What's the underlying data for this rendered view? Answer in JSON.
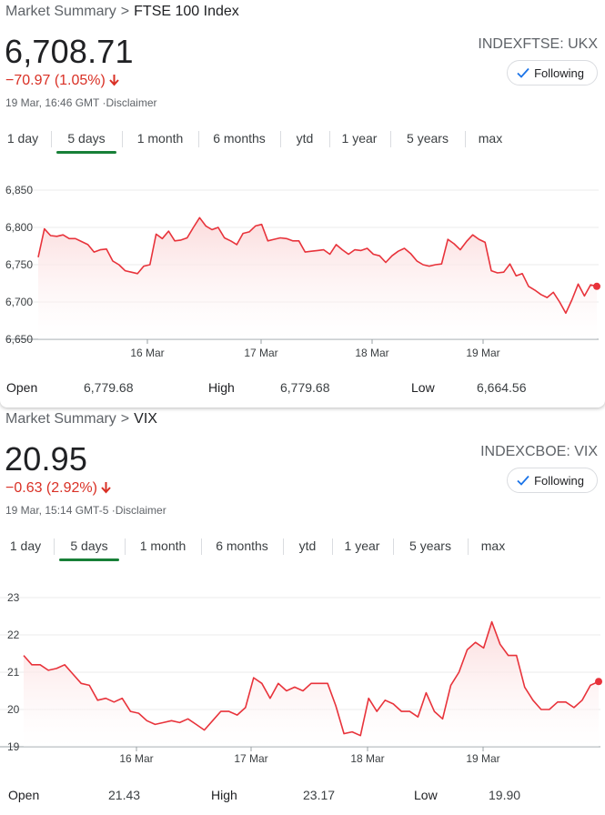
{
  "colors": {
    "line": "#e8333b",
    "fill_top": "#fbd9da",
    "grid": "#ebebeb",
    "active_tab": "#188038",
    "down": "#d93025"
  },
  "tabs": [
    "1 day",
    "5 days",
    "1 month",
    "6 months",
    "ytd",
    "1 year",
    "5 years",
    "max"
  ],
  "active_tab_index": 1,
  "cards": [
    {
      "breadcrumb": {
        "parent": "Market Summary",
        "separator": ">",
        "current": "FTSE 100 Index"
      },
      "price": "6,708.71",
      "change": "−70.97 (1.05%)",
      "change_icon": "arrow-down-icon",
      "timestamp": "19 Mar, 16:46 GMT ·Disclaimer",
      "ticker": "INDEXFTSE: UKX",
      "follow_label": "Following",
      "follow_icon": "check-icon",
      "stats": {
        "open_label": "Open",
        "open": "6,779.68",
        "high_label": "High",
        "high": "6,779.68",
        "low_label": "Low",
        "low": "6,664.56"
      },
      "chart_data": {
        "type": "area",
        "x_tick_labels": [
          "16 Mar",
          "17 Mar",
          "18 Mar",
          "19 Mar"
        ],
        "y_tick_labels": [
          "6,850",
          "6,800",
          "6,750",
          "6,700",
          "6,650"
        ],
        "y_ticks": [
          6850,
          6800,
          6750,
          6700,
          6650
        ],
        "ylim": [
          6650,
          6850
        ],
        "xlim": [
          0,
          4
        ],
        "values": [
          6760,
          6798,
          6789,
          6788,
          6790,
          6785,
          6785,
          6781,
          6777,
          6767,
          6770,
          6771,
          6755,
          6750,
          6742,
          6740,
          6738,
          6748,
          6750,
          6791,
          6785,
          6795,
          6782,
          6783,
          6786,
          6800,
          6813,
          6802,
          6797,
          6800,
          6786,
          6782,
          6777,
          6792,
          6794,
          6802,
          6804,
          6782,
          6784,
          6786,
          6785,
          6782,
          6782,
          6767,
          6768,
          6769,
          6770,
          6764,
          6777,
          6770,
          6764,
          6770,
          6769,
          6772,
          6764,
          6762,
          6753,
          6762,
          6768,
          6772,
          6765,
          6755,
          6750,
          6748,
          6750,
          6751,
          6784,
          6778,
          6770,
          6781,
          6790,
          6784,
          6780,
          6742,
          6739,
          6740,
          6751,
          6735,
          6738,
          6721,
          6716,
          6710,
          6706,
          6713,
          6700,
          6685,
          6703,
          6724,
          6708,
          6723,
          6721
        ],
        "last_point": 6721,
        "grid": true
      }
    },
    {
      "breadcrumb": {
        "parent": "Market Summary",
        "separator": ">",
        "current": "VIX"
      },
      "price": "20.95",
      "change": "−0.63 (2.92%)",
      "change_icon": "arrow-down-icon",
      "timestamp": "19 Mar, 15:14 GMT-5 ·Disclaimer",
      "ticker": "INDEXCBOE: VIX",
      "follow_label": "Following",
      "follow_icon": "check-icon",
      "stats": {
        "open_label": "Open",
        "open": "21.43",
        "high_label": "High",
        "high": "23.17",
        "low_label": "Low",
        "low": "19.90"
      },
      "chart_data": {
        "type": "area",
        "x_tick_labels": [
          "16 Mar",
          "17 Mar",
          "18 Mar",
          "19 Mar"
        ],
        "y_tick_labels": [
          "23",
          "22",
          "21",
          "20",
          "19"
        ],
        "y_ticks": [
          23,
          22,
          21,
          20,
          19
        ],
        "ylim": [
          19,
          23
        ],
        "xlim": [
          0,
          4
        ],
        "values": [
          21.45,
          21.2,
          21.2,
          21.05,
          21.1,
          21.2,
          20.95,
          20.7,
          20.65,
          20.25,
          20.3,
          20.2,
          20.3,
          19.95,
          19.9,
          19.7,
          19.6,
          19.65,
          19.7,
          19.65,
          19.75,
          19.6,
          19.45,
          19.7,
          19.95,
          19.95,
          19.85,
          20.05,
          20.85,
          20.7,
          20.3,
          20.7,
          20.5,
          20.6,
          20.5,
          20.7,
          20.7,
          20.7,
          20.1,
          19.35,
          19.4,
          19.3,
          20.3,
          19.95,
          20.25,
          20.15,
          19.95,
          19.95,
          19.8,
          20.45,
          19.95,
          19.75,
          20.65,
          21.0,
          21.6,
          21.8,
          21.65,
          22.35,
          21.75,
          21.45,
          21.45,
          20.6,
          20.25,
          20.0,
          20.0,
          20.2,
          20.2,
          20.05,
          20.25,
          20.65,
          20.75
        ],
        "last_point": 20.75,
        "grid": true
      }
    }
  ]
}
